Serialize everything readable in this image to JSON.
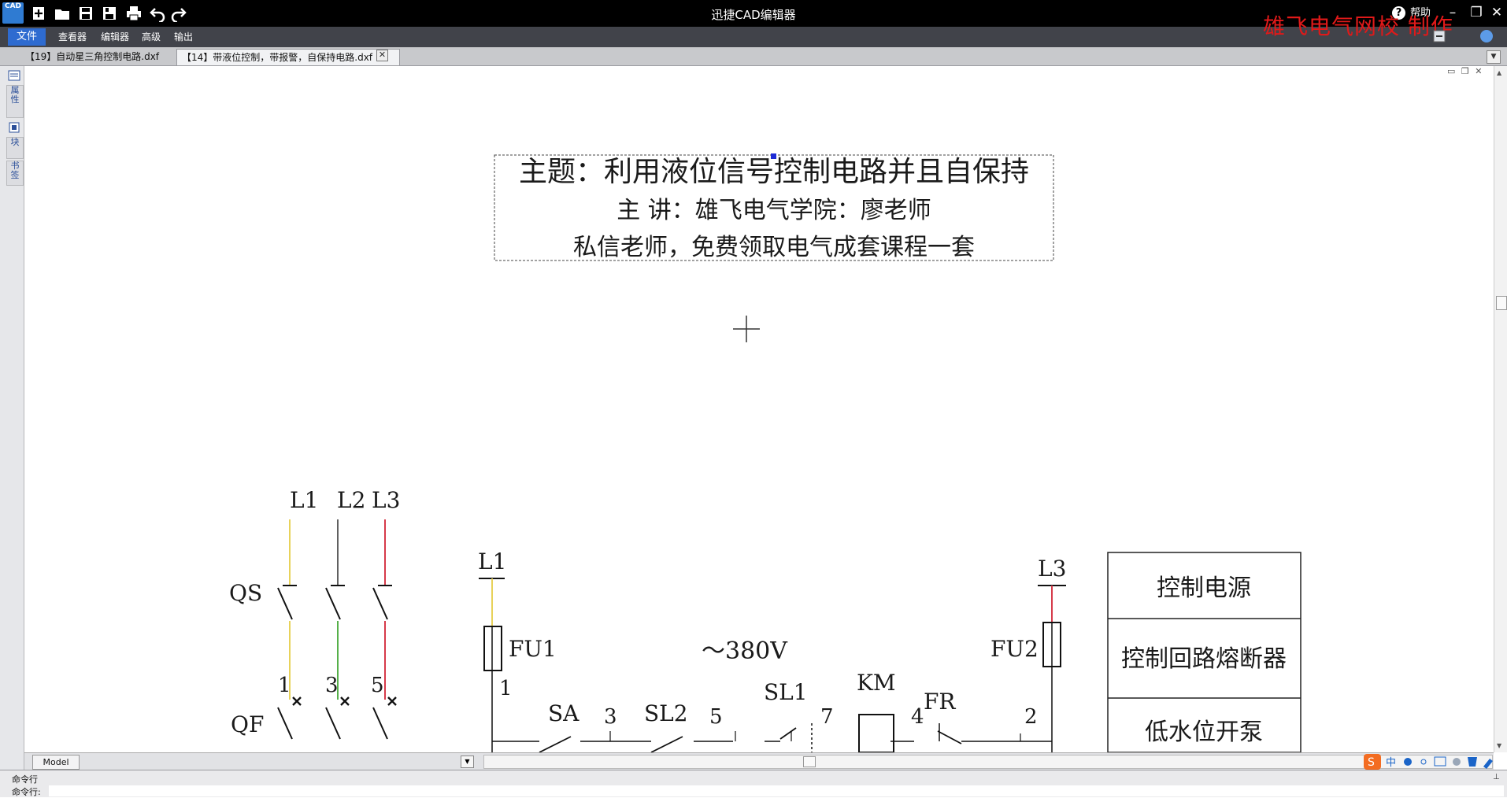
{
  "app": {
    "logo_text": "CAD",
    "title": "迅捷CAD编辑器",
    "help_label": "帮助",
    "watermark": "雄飞电气网校  制作"
  },
  "menu": {
    "file": "文件",
    "viewer": "查看器",
    "editor": "编辑器",
    "advanced": "高级",
    "output": "输出"
  },
  "tabs": [
    {
      "label": "【19】自动星三角控制电路.dxf"
    },
    {
      "label": "【14】带液位控制，带报警，自保持电路.dxf"
    }
  ],
  "side_panel": {
    "tab1": "属性",
    "tab2": "块",
    "tab3": "书签"
  },
  "drawing": {
    "title_block": {
      "line1": "主题：利用液位信号控制电路并且自保持",
      "line2": "主  讲：雄飞电气学院：廖老师",
      "line3": "私信老师，免费领取电气成套课程一套"
    },
    "power": {
      "L1": "L1",
      "L2": "L2",
      "L3": "L3",
      "QS": "QS",
      "QF": "QF",
      "n1": "1",
      "n3": "3",
      "n5": "5"
    },
    "control": {
      "L1": "L1",
      "L3": "L3",
      "FU1": "FU1",
      "FU2": "FU2",
      "voltage": "～380V",
      "n1": "1",
      "SA": "SA",
      "n3": "3",
      "SL2": "SL2",
      "n5": "5",
      "SL1": "SL1",
      "n7": "7",
      "KM": "KM",
      "n4": "4",
      "FR": "FR",
      "n2": "2"
    },
    "legend": [
      "控制电源",
      "控制回路熔断器",
      "低水位开泵"
    ]
  },
  "bottom": {
    "model_tab": "Model"
  },
  "command": {
    "line1": "命令行",
    "line2": "命令行:"
  },
  "colors": {
    "titlebar": "#000000",
    "menubar": "#41434a",
    "file_menu": "#2e6bd0",
    "watermark": "#e01919",
    "wire_L1": "#e8d25a",
    "wire_L2": "#2a2a2a",
    "wire_L3": "#d63a4a",
    "wire_green": "#56b04a"
  }
}
